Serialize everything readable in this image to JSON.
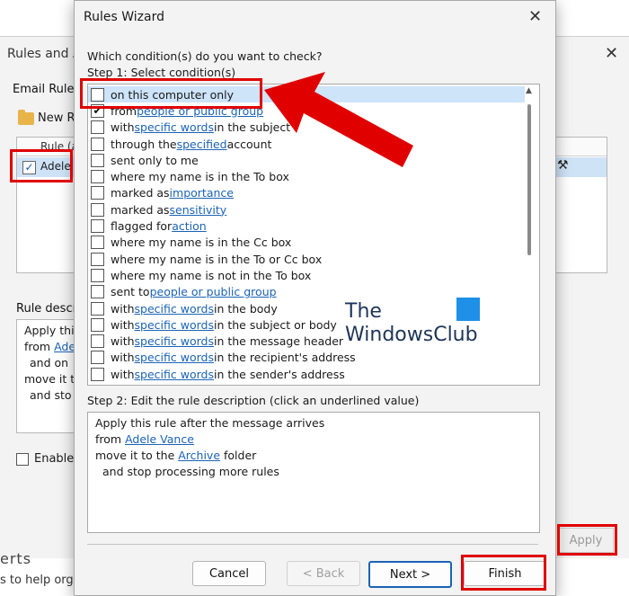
{
  "background_window": {
    "title": "Rules and A",
    "email_rules_label": "Email Rule:",
    "new_rule_label": "New R",
    "list_header": "Rule (a",
    "list_row_label": "Adele",
    "rule_description_label": "Rule descr",
    "desc_lines": [
      "Apply thi",
      "from ",
      "and on",
      "move it t",
      "and sto"
    ],
    "desc_link": "Adel",
    "enable_label": "Enable",
    "apply_label": "Apply",
    "footer_text_1": "erts",
    "footer_text_2": "s to help orga"
  },
  "dialog": {
    "title": "Rules Wizard",
    "question": "Which condition(s) do you want to check?",
    "step1_label": "Step 1: Select condition(s)",
    "conditions": [
      {
        "before": "on this computer only",
        "link": "",
        "after": "",
        "checked": false
      },
      {
        "before": "from ",
        "link": "people or public group",
        "after": "",
        "checked": true
      },
      {
        "before": "with ",
        "link": "specific words",
        "after": " in the subject",
        "checked": false
      },
      {
        "before": "through the ",
        "link": "specified",
        "after": " account",
        "checked": false
      },
      {
        "before": "sent only to me",
        "link": "",
        "after": "",
        "checked": false
      },
      {
        "before": "where my name is in the To box",
        "link": "",
        "after": "",
        "checked": false
      },
      {
        "before": "marked as ",
        "link": "importance",
        "after": "",
        "checked": false
      },
      {
        "before": "marked as ",
        "link": "sensitivity",
        "after": "",
        "checked": false
      },
      {
        "before": "flagged for ",
        "link": "action",
        "after": "",
        "checked": false
      },
      {
        "before": "where my name is in the Cc box",
        "link": "",
        "after": "",
        "checked": false
      },
      {
        "before": "where my name is in the To or Cc box",
        "link": "",
        "after": "",
        "checked": false
      },
      {
        "before": "where my name is not in the To box",
        "link": "",
        "after": "",
        "checked": false
      },
      {
        "before": "sent to ",
        "link": "people or public group",
        "after": "",
        "checked": false
      },
      {
        "before": "with ",
        "link": "specific words",
        "after": " in the body",
        "checked": false
      },
      {
        "before": "with ",
        "link": "specific words",
        "after": " in the subject or body",
        "checked": false
      },
      {
        "before": "with ",
        "link": "specific words",
        "after": " in the message header",
        "checked": false
      },
      {
        "before": "with ",
        "link": "specific words",
        "after": " in the recipient's address",
        "checked": false
      },
      {
        "before": "with ",
        "link": "specific words",
        "after": " in the sender's address",
        "checked": false
      }
    ],
    "step2_label": "Step 2: Edit the rule description (click an underlined value)",
    "description": {
      "line1": "Apply this rule after the message arrives",
      "line2_before": "from ",
      "line2_link": "Adele Vance",
      "line3_before": "move it to the ",
      "line3_link": "Archive",
      "line3_after": " folder",
      "line4": "and stop processing more rules"
    },
    "buttons": {
      "cancel": "Cancel",
      "back": "< Back",
      "next": "Next >",
      "finish": "Finish"
    }
  },
  "watermark": {
    "line1": "The",
    "line2": "WindowsClub"
  },
  "colors": {
    "annotation_red": "#e00000",
    "link_blue": "#1b63b5",
    "selection_blue": "#cde4f9"
  }
}
